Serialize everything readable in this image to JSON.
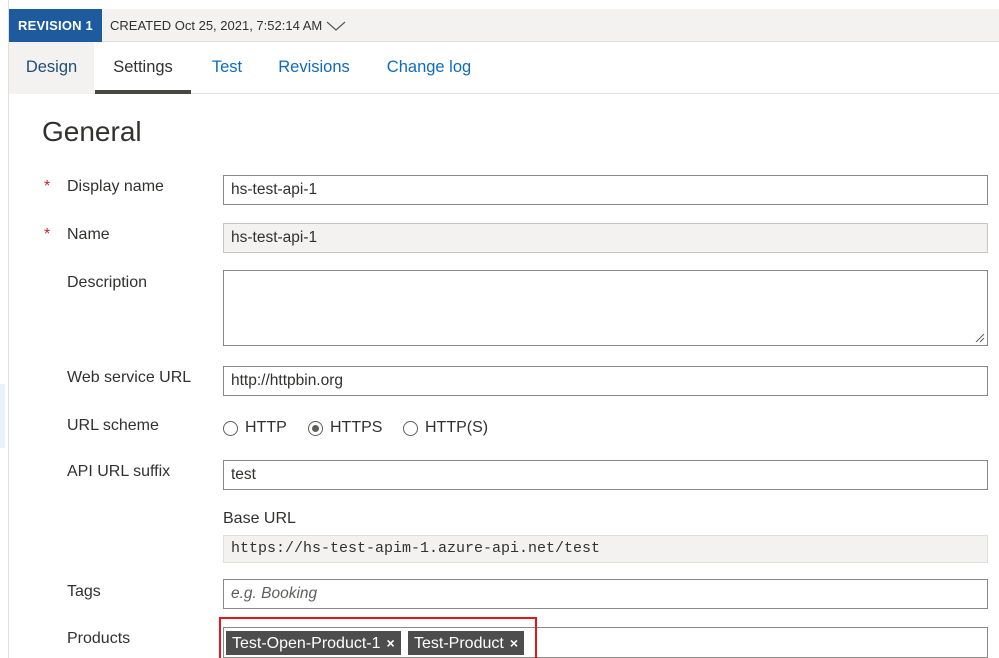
{
  "revision": {
    "badge": "REVISION 1",
    "created": "CREATED Oct 25, 2021, 7:52:14 AM"
  },
  "tabs": [
    {
      "label": "Design"
    },
    {
      "label": "Settings"
    },
    {
      "label": "Test"
    },
    {
      "label": "Revisions"
    },
    {
      "label": "Change log"
    }
  ],
  "general": {
    "title": "General",
    "required_marker": "*",
    "display_name": {
      "label": "Display name",
      "value": "hs-test-api-1"
    },
    "name": {
      "label": "Name",
      "value": "hs-test-api-1"
    },
    "description": {
      "label": "Description",
      "value": ""
    },
    "web_service_url": {
      "label": "Web service URL",
      "value": "http://httpbin.org"
    },
    "url_scheme": {
      "label": "URL scheme",
      "options": [
        "HTTP",
        "HTTPS",
        "HTTP(S)"
      ],
      "selected": "HTTPS"
    },
    "api_url_suffix": {
      "label": "API URL suffix",
      "value": "test"
    },
    "base_url": {
      "label": "Base URL",
      "value": "https://hs-test-apim-1.azure-api.net/test"
    },
    "tags": {
      "label": "Tags",
      "placeholder": "e.g. Booking",
      "value": ""
    },
    "products": {
      "label": "Products",
      "chips": [
        "Test-Open-Product-1",
        "Test-Product"
      ],
      "remove_glyph": "×"
    }
  },
  "colors": {
    "revision_badge": "#1e5b9e",
    "link_tab": "#0f6cbd",
    "required": "#c4262e",
    "chip_bg": "#4d4d4d",
    "highlight": "#e3161c"
  }
}
